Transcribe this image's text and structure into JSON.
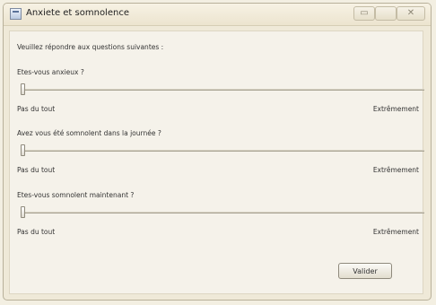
{
  "window": {
    "title": "Anxiete et somnolence",
    "controls": {
      "minimize": "▭",
      "maximize": "",
      "close": "✕"
    }
  },
  "form": {
    "intro": "Veuillez répondre aux questions suivantes :",
    "questions": [
      {
        "label": "Etes-vous anxieux ?",
        "min_label": "Pas du tout",
        "max_label": "Extrêmement",
        "value": 0
      },
      {
        "label": "Avez vous été somnolent dans la journée ?",
        "min_label": "Pas du tout",
        "max_label": "Extrêmement",
        "value": 0
      },
      {
        "label": "Etes-vous somnolent maintenant ?",
        "min_label": "Pas du tout",
        "max_label": "Extrêmement",
        "value": 0
      }
    ],
    "submit_label": "Valider"
  },
  "colors": {
    "background": "#f3efe2",
    "titlebar": "#ece4cf"
  },
  "icons": {
    "app": "window-app-icon"
  }
}
